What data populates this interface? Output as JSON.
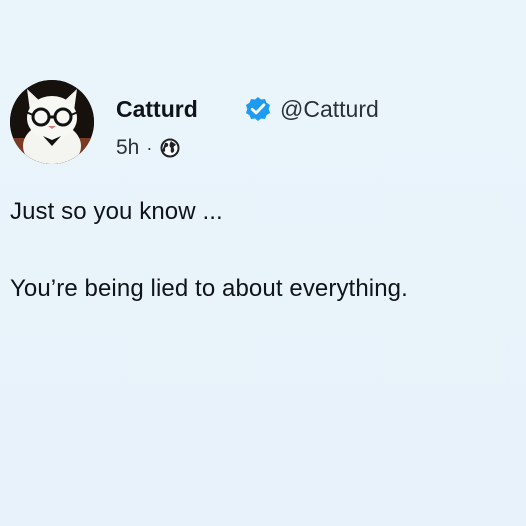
{
  "post": {
    "author": {
      "display_name": "Catturd",
      "handle": "@Catturd",
      "verified": true,
      "avatar": "cat-with-glasses"
    },
    "timestamp": "5h",
    "separator": "·",
    "visibility_icon": "globe-icon",
    "lines": [
      "Just so you know ...",
      "You’re being lied to about everything."
    ]
  },
  "colors": {
    "background": "#e8f3fb",
    "text": "#0f1419",
    "verified_badge": "#1d9bf0"
  }
}
